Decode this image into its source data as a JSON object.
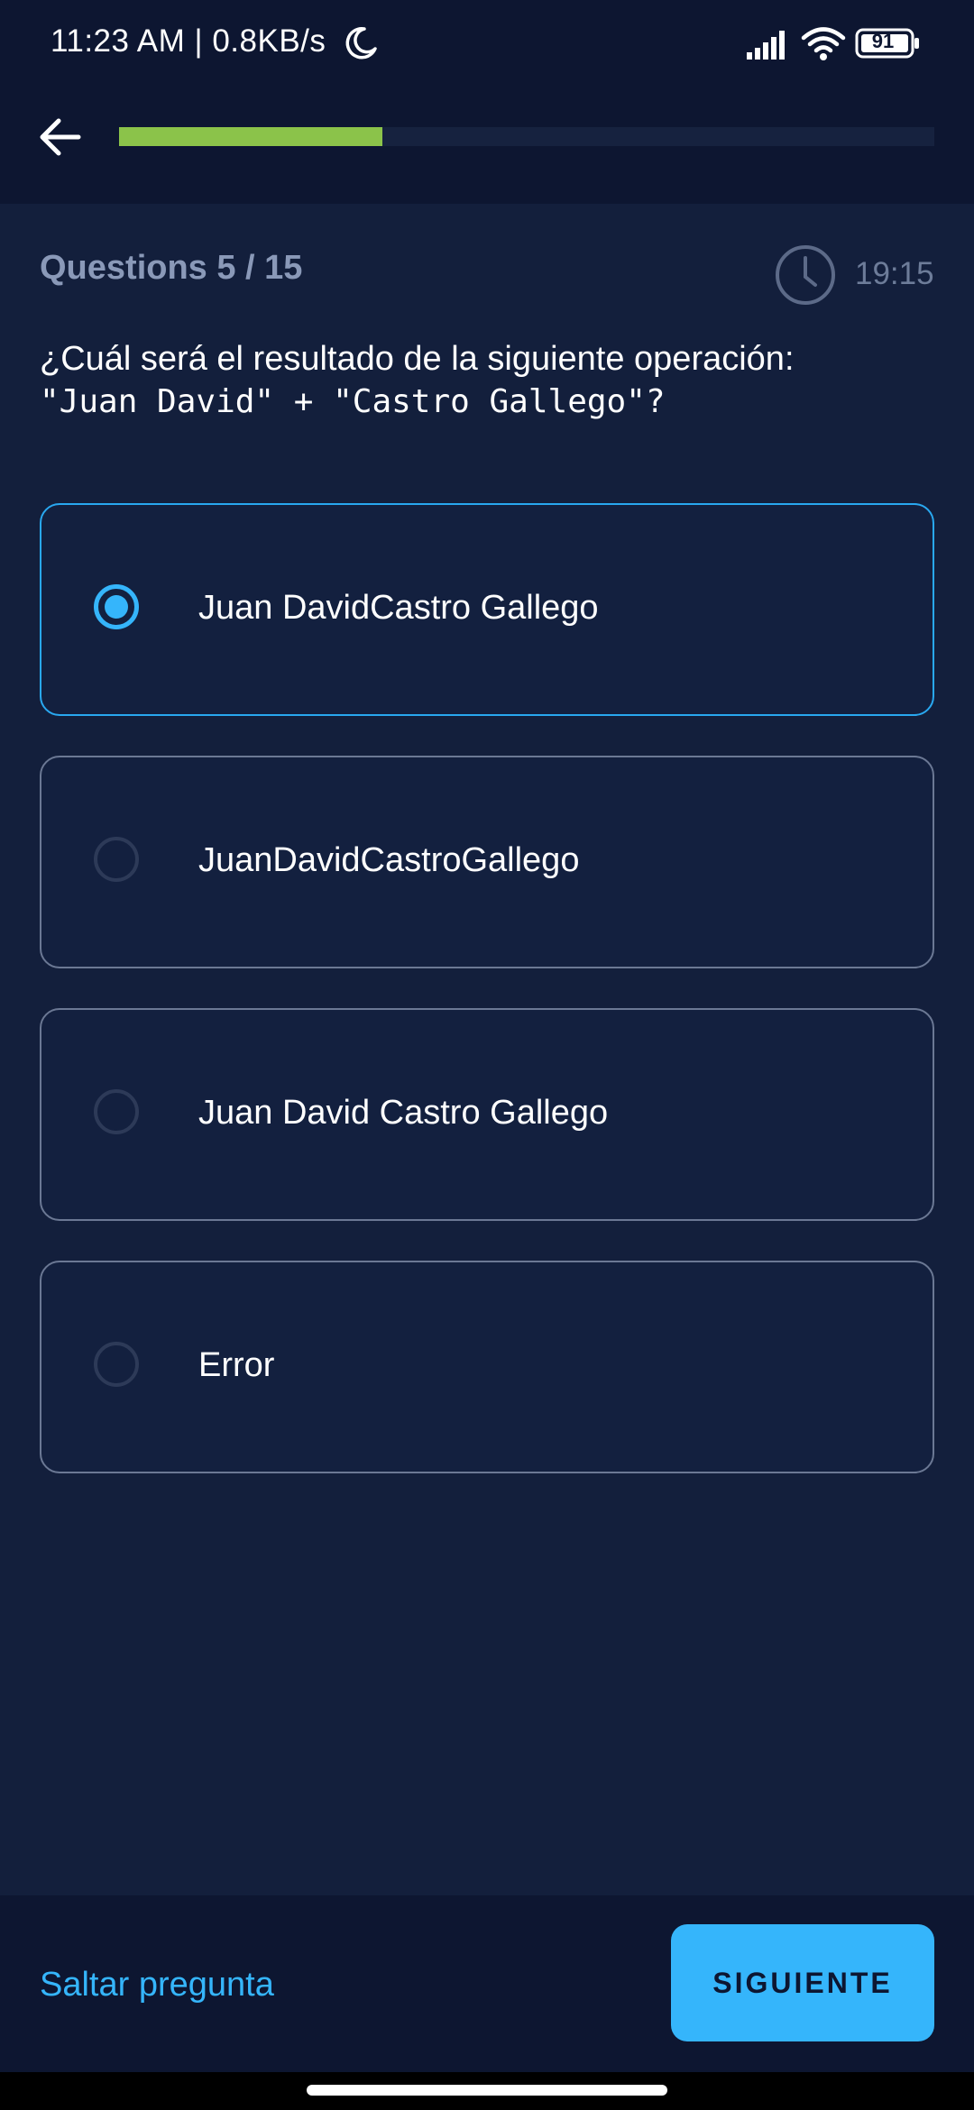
{
  "status_bar": {
    "time": "11:23 AM | 0.8KB/s",
    "battery": "91",
    "icons": [
      "moon-icon",
      "signal-icon",
      "wifi-icon",
      "battery-icon"
    ]
  },
  "header": {
    "back_icon": "arrow-left-icon",
    "progress_fraction": 0.3235,
    "progress_color": "#8bc34a"
  },
  "quiz": {
    "question_count": "Questions 5 / 15",
    "timer": "19:15",
    "question_text": "¿Cuál será el resultado de la siguiente operación:",
    "question_code": "\"Juan David\" + \"Castro Gallego\"?",
    "options": [
      {
        "label": "Juan DavidCastro Gallego",
        "selected": true
      },
      {
        "label": "JuanDavidCastroGallego",
        "selected": false
      },
      {
        "label": "Juan David Castro Gallego",
        "selected": false
      },
      {
        "label": "Error",
        "selected": false
      }
    ]
  },
  "footer": {
    "skip_label": "Saltar pregunta",
    "next_label": "SIGUIENTE"
  },
  "colors": {
    "background": "#131f3c",
    "bar": "#0d1631",
    "accent": "#35b5fb",
    "progress": "#8bc34a"
  }
}
